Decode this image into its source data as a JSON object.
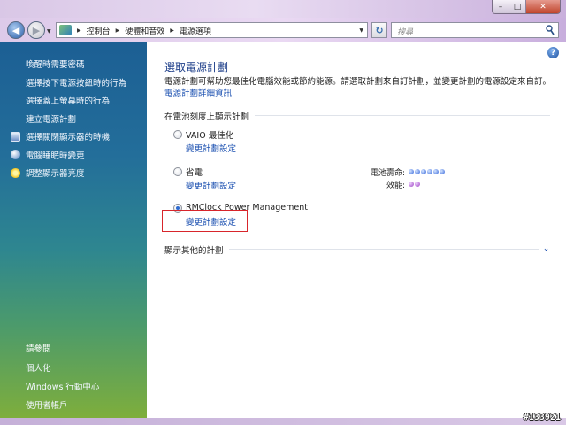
{
  "window": {
    "minimize": "–",
    "maximize": "□",
    "close": "✕"
  },
  "nav": {
    "back_glyph": "◀",
    "forward_glyph": "▶",
    "dropdown_glyph": "▼",
    "breadcrumb": [
      "控制台",
      "硬體和音效",
      "電源選項"
    ],
    "crumb_sep": "▶",
    "refresh_glyph": "↻",
    "search_placeholder": "搜尋"
  },
  "sidebar": {
    "tasks": [
      {
        "label": "喚醒時需要密碼",
        "icon": ""
      },
      {
        "label": "選擇按下電源按鈕時的行為",
        "icon": ""
      },
      {
        "label": "選擇蓋上螢幕時的行為",
        "icon": ""
      },
      {
        "label": "建立電源計劃",
        "icon": ""
      },
      {
        "label": "選擇關閉顯示器的時機",
        "icon": "monitor-icon"
      },
      {
        "label": "電腦睡眠時變更",
        "icon": "moon-icon"
      },
      {
        "label": "調整顯示器亮度",
        "icon": "sun-icon"
      }
    ],
    "see_also_title": "請參閱",
    "see_also": [
      "個人化",
      "Windows 行動中心",
      "使用者帳戶"
    ]
  },
  "main": {
    "help_glyph": "?",
    "title": "選取電源計劃",
    "description": "電源計劃可幫助您最佳化電腦效能或節約能源。請選取計劃來自訂計劃，並變更計劃的電源設定來自訂。",
    "description_link": "電源計劃詳細資訊",
    "section_label": "在電池刻度上顯示計劃",
    "plans": [
      {
        "name": "VAIO 最佳化",
        "link": "變更計劃設定",
        "selected": false
      },
      {
        "name": "省電",
        "link": "變更計劃設定",
        "selected": false
      },
      {
        "name": "RMClock Power Management",
        "link": "變更計劃設定",
        "selected": true
      }
    ],
    "stats": {
      "battery_label": "電池壽命:",
      "battery_level": 6,
      "performance_label": "效能:",
      "performance_level": 2
    },
    "more_plans": "顯示其他的計劃",
    "chevron_glyph": "⌄"
  },
  "watermark": "#133921",
  "colors": {
    "accent_link": "#1a4fb0",
    "title": "#1e3f8a",
    "highlight": "#d8252b"
  }
}
